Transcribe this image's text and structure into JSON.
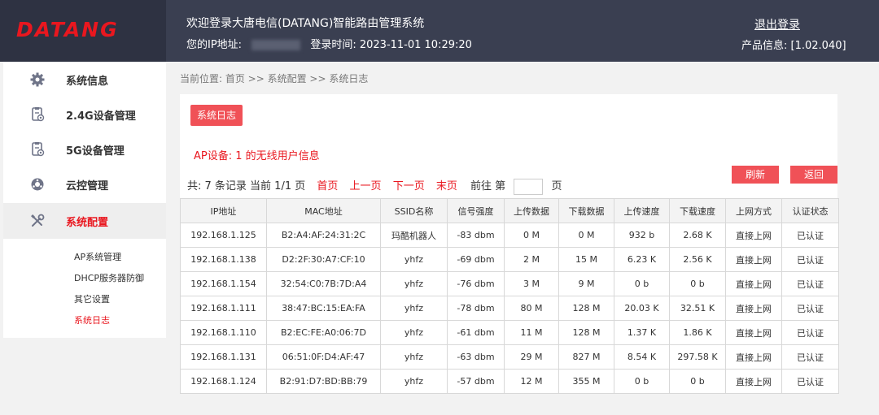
{
  "header": {
    "logo": "DATANG",
    "welcome": "欢迎登录大唐电信(DATANG)智能路由管理系统",
    "ip_label": "您的IP地址:",
    "login_time": "登录时间: 2023-11-01 10:29:20",
    "logout": "退出登录",
    "version": "产品信息: [1.02.040]"
  },
  "sidebar": {
    "items": [
      {
        "label": "系统信息",
        "icon": "gear-icon"
      },
      {
        "label": "2.4G设备管理",
        "icon": "device-icon"
      },
      {
        "label": "5G设备管理",
        "icon": "device-icon"
      },
      {
        "label": "云控管理",
        "icon": "cloud-icon"
      },
      {
        "label": "系统配置",
        "icon": "tools-icon"
      }
    ],
    "sub_items": [
      {
        "label": "AP系统管理"
      },
      {
        "label": "DHCP服务器防御"
      },
      {
        "label": "其它设置"
      },
      {
        "label": "系统日志"
      }
    ]
  },
  "breadcrumb": "当前位置: 首页 >> 系统配置 >> 系统日志",
  "panel": {
    "tab": "系统日志",
    "ap_title": "AP设备: 1 的无线用户信息",
    "refresh": "刷新",
    "back": "返回"
  },
  "pager": {
    "summary": "共: 7 条记录 当前 1/1 页",
    "first": "首页",
    "prev": "上一页",
    "next": "下一页",
    "last": "末页",
    "goto_prefix": "前往 第",
    "goto_suffix": "页",
    "page_value": ""
  },
  "table": {
    "headers": [
      "IP地址",
      "MAC地址",
      "SSID名称",
      "信号强度",
      "上传数据",
      "下载数据",
      "上传速度",
      "下载速度",
      "上网方式",
      "认证状态"
    ],
    "rows": [
      [
        "192.168.1.125",
        "B2:A4:AF:24:31:2C",
        "玛酷机器人",
        "-83 dbm",
        "0 M",
        "0 M",
        "932 b",
        "2.68 K",
        "直接上网",
        "已认证"
      ],
      [
        "192.168.1.138",
        "D2:2F:30:A7:CF:10",
        "yhfz",
        "-69 dbm",
        "2 M",
        "15 M",
        "6.23 K",
        "2.56 K",
        "直接上网",
        "已认证"
      ],
      [
        "192.168.1.154",
        "32:54:C0:7B:7D:A4",
        "yhfz",
        "-76 dbm",
        "3 M",
        "9 M",
        "0 b",
        "0 b",
        "直接上网",
        "已认证"
      ],
      [
        "192.168.1.111",
        "38:47:BC:15:EA:FA",
        "yhfz",
        "-78 dbm",
        "80 M",
        "128 M",
        "20.03 K",
        "32.51 K",
        "直接上网",
        "已认证"
      ],
      [
        "192.168.1.110",
        "B2:EC:FE:A0:06:7D",
        "yhfz",
        "-61 dbm",
        "11 M",
        "128 M",
        "1.37 K",
        "1.86 K",
        "直接上网",
        "已认证"
      ],
      [
        "192.168.1.131",
        "06:51:0F:D4:AF:47",
        "yhfz",
        "-63 dbm",
        "29 M",
        "827 M",
        "8.54 K",
        "297.58 K",
        "直接上网",
        "已认证"
      ],
      [
        "192.168.1.124",
        "B2:91:D7:BD:BB:79",
        "yhfz",
        "-57 dbm",
        "12 M",
        "355 M",
        "0 b",
        "0 b",
        "直接上网",
        "已认证"
      ]
    ]
  },
  "colors": {
    "accent": "#e9171f",
    "button": "#f05157",
    "header_bg": "#3a3f51",
    "logo_bg": "#2e3242"
  }
}
